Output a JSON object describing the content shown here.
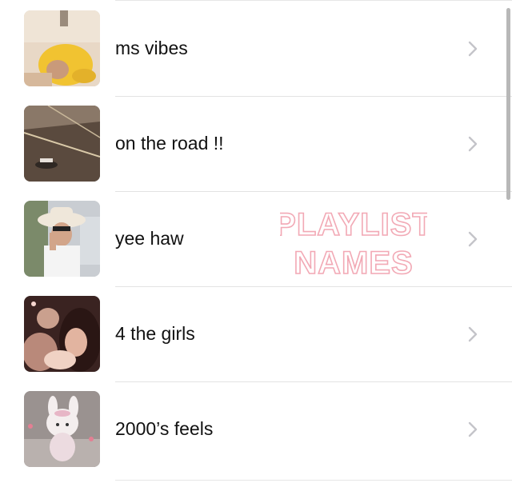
{
  "playlists": [
    {
      "title": "ms vibes",
      "thumbnail": "person-in-yellow-hat-photo"
    },
    {
      "title": "on the road !!",
      "thumbnail": "road-at-night-photo"
    },
    {
      "title": "yee haw",
      "thumbnail": "cowboy-hat-photo"
    },
    {
      "title": "4 the girls",
      "thumbnail": "girls-group-photo"
    },
    {
      "title": "2000’s feels",
      "thumbnail": "plush-toy-photo"
    }
  ],
  "overlay": {
    "line1": "PLAYLIST",
    "line2": "NAMES"
  },
  "colors": {
    "text": "#111111",
    "chevron": "#c4c4c9",
    "overlay_stroke": "#f2a9b5",
    "separator": "#e3e3e3"
  }
}
